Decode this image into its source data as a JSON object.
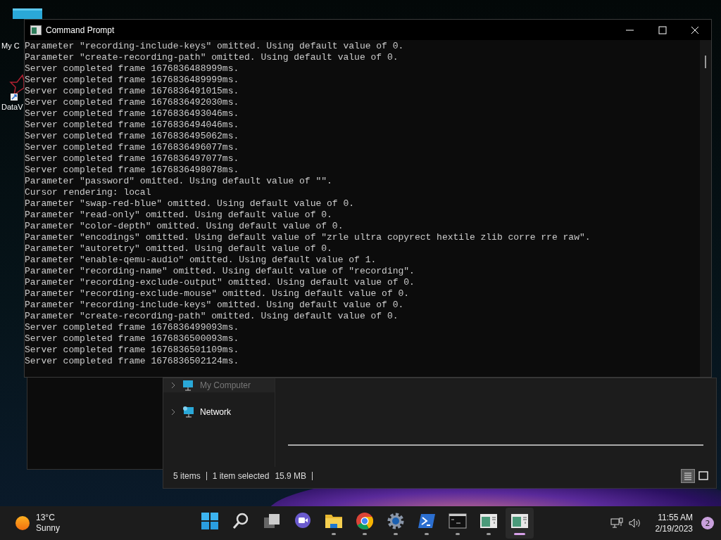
{
  "desktop_icons": [
    {
      "label": "My C",
      "kind": "monitor"
    },
    {
      "label": "DataV",
      "kind": "app"
    }
  ],
  "explorer": {
    "nav_items": [
      {
        "label": "My Computer",
        "kind": "computer",
        "expanded": false
      },
      {
        "label": "Network",
        "kind": "network",
        "expanded": false
      }
    ],
    "status_bar": {
      "items_count": "5 items",
      "selection": "1 item selected",
      "size": "15.9 MB"
    },
    "view_buttons": [
      {
        "kind": "details",
        "selected": true
      },
      {
        "kind": "preview",
        "selected": false
      }
    ]
  },
  "console": {
    "title": "Command Prompt",
    "lines": [
      "Parameter \"recording-include-keys\" omitted. Using default value of 0.",
      "Parameter \"create-recording-path\" omitted. Using default value of 0.",
      "Server completed frame 1676836488999ms.",
      "Server completed frame 1676836489999ms.",
      "Server completed frame 1676836491015ms.",
      "Server completed frame 1676836492030ms.",
      "Server completed frame 1676836493046ms.",
      "Server completed frame 1676836494046ms.",
      "Server completed frame 1676836495062ms.",
      "Server completed frame 1676836496077ms.",
      "Server completed frame 1676836497077ms.",
      "Server completed frame 1676836498078ms.",
      "Parameter \"password\" omitted. Using default value of \"\".",
      "Cursor rendering: local",
      "Parameter \"swap-red-blue\" omitted. Using default value of 0.",
      "Parameter \"read-only\" omitted. Using default value of 0.",
      "Parameter \"color-depth\" omitted. Using default value of 0.",
      "Parameter \"encodings\" omitted. Using default value of \"zrle ultra copyrect hextile zlib corre rre raw\".",
      "Parameter \"autoretry\" omitted. Using default value of 0.",
      "Parameter \"enable-qemu-audio\" omitted. Using default value of 1.",
      "Parameter \"recording-name\" omitted. Using default value of \"recording\".",
      "Parameter \"recording-exclude-output\" omitted. Using default value of 0.",
      "Parameter \"recording-exclude-mouse\" omitted. Using default value of 0.",
      "Parameter \"recording-include-keys\" omitted. Using default value of 0.",
      "Parameter \"create-recording-path\" omitted. Using default value of 0.",
      "Server completed frame 1676836499093ms.",
      "Server completed frame 1676836500093ms.",
      "Server completed frame 1676836501109ms.",
      "Server completed frame 1676836502124ms."
    ]
  },
  "taskbar": {
    "weather": {
      "temperature": "13°C",
      "condition": "Sunny"
    },
    "apps": [
      {
        "kind": "start",
        "running": false,
        "active": false
      },
      {
        "kind": "search",
        "running": false,
        "active": false
      },
      {
        "kind": "taskview",
        "running": false,
        "active": false
      },
      {
        "kind": "chat",
        "running": false,
        "active": false
      },
      {
        "kind": "folder",
        "running": true,
        "active": false
      },
      {
        "kind": "browser",
        "running": true,
        "active": false
      },
      {
        "kind": "settings",
        "running": true,
        "active": false
      },
      {
        "kind": "powershell",
        "running": true,
        "active": false
      },
      {
        "kind": "terminal",
        "running": true,
        "active": false
      },
      {
        "kind": "window",
        "running": true,
        "active": false
      },
      {
        "kind": "window",
        "running": true,
        "active": true
      }
    ],
    "time": "11:55 AM",
    "date": "2/19/2023",
    "notification_count": "2"
  }
}
